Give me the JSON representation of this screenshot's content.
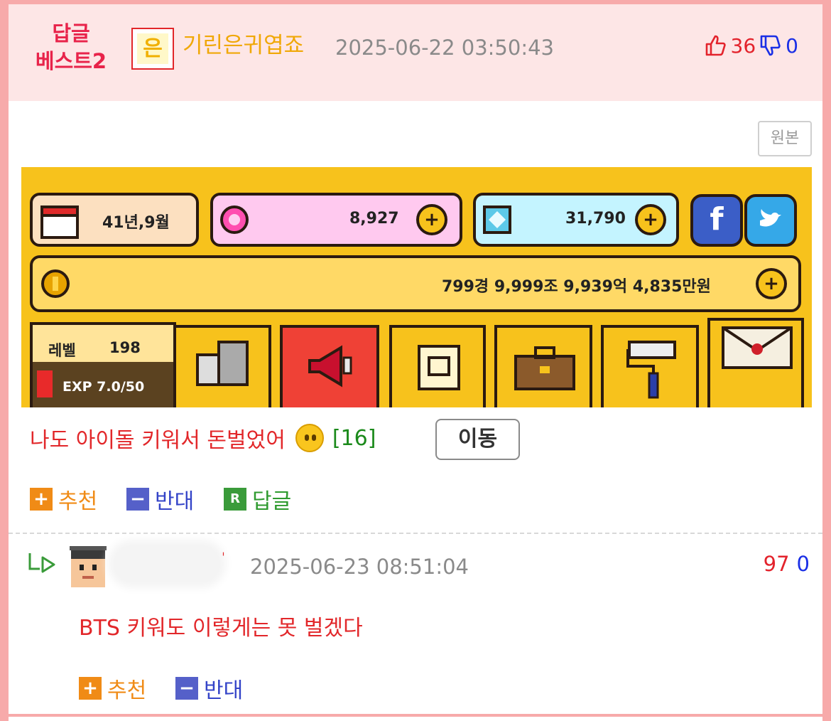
{
  "header": {
    "best_line1": "답글",
    "best_line2": "베스트2",
    "level_badge": "은",
    "nickname": "기린은귀엽죠",
    "datetime": "2025-06-22 03:50:43",
    "upvotes": "36",
    "downvotes": "0"
  },
  "original_button": "원본",
  "game": {
    "date": "41년,9월",
    "gems": "8,927",
    "diamonds": "31,790",
    "money": "799경 9,999조 9,939억 4,835만원",
    "level_label": "레벨",
    "level_value": "198",
    "exp": "EXP 7.0/50",
    "facebook": "f",
    "colors": {
      "gold": "#f7c21c",
      "pink": "#ffc9ef",
      "cyan": "#c4f4ff",
      "red_tile": "#ef4136"
    }
  },
  "post": {
    "caption": "나도 아이돌 키워서 돈벌었어",
    "emoji": "neutral-face",
    "comment_count": "[16]",
    "move_button": "이동",
    "actions": {
      "recommend": "추천",
      "oppose": "반대",
      "reply": "답글",
      "plus": "+",
      "minus": "−",
      "reply_icon": "R"
    }
  },
  "reply": {
    "datetime": "2025-06-23 08:51:04",
    "upvotes": "97",
    "downvotes": "0",
    "text": "BTS 키워도 이렇게는 못 벌겠다",
    "actions": {
      "recommend": "추천",
      "oppose": "반대",
      "plus": "+",
      "minus": "−"
    }
  }
}
